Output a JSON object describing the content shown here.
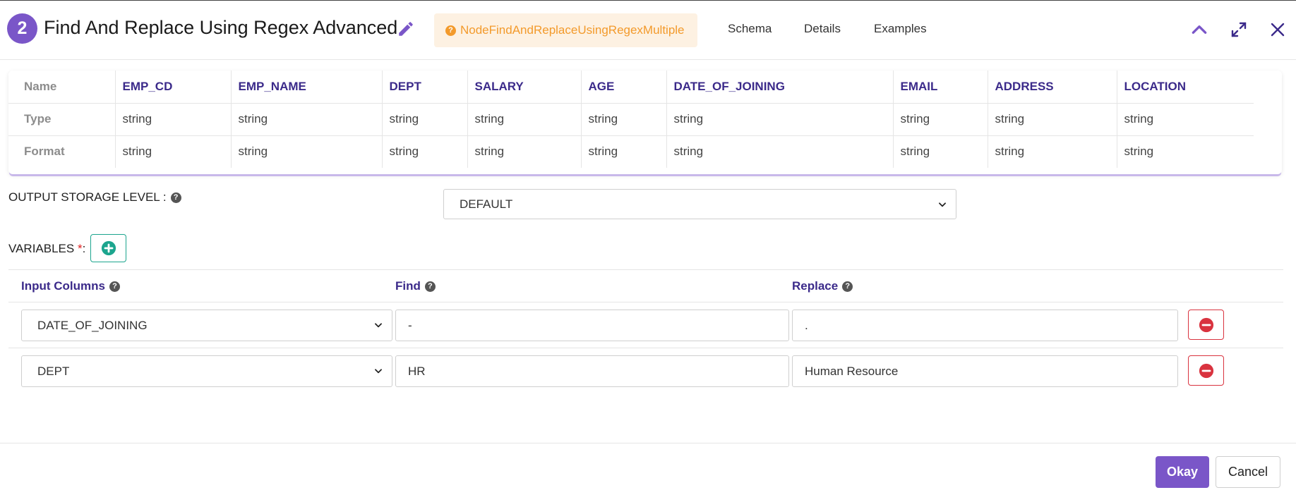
{
  "header": {
    "step_number": "2",
    "title": "Find And Replace Using Regex Advanced",
    "node_name": "NodeFindAndReplaceUsingRegexMultiple",
    "tabs": [
      "Schema",
      "Details",
      "Examples"
    ]
  },
  "schema": {
    "row_labels": [
      "Name",
      "Type",
      "Format"
    ],
    "columns": [
      "EMP_CD",
      "EMP_NAME",
      "DEPT",
      "SALARY",
      "AGE",
      "DATE_OF_JOINING",
      "EMAIL",
      "ADDRESS",
      "LOCATION"
    ],
    "types": [
      "string",
      "string",
      "string",
      "string",
      "string",
      "string",
      "string",
      "string",
      "string"
    ],
    "formats": [
      "string",
      "string",
      "string",
      "string",
      "string",
      "string",
      "string",
      "string",
      "string"
    ]
  },
  "storage": {
    "label": "OUTPUT STORAGE LEVEL :",
    "value": "DEFAULT"
  },
  "variables": {
    "label": "VARIABLES",
    "required_mark": "*",
    "separator": ":",
    "headers": {
      "input_columns": "Input Columns",
      "find": "Find",
      "replace": "Replace"
    },
    "rows": [
      {
        "input_column": "DATE_OF_JOINING",
        "find": "-",
        "replace": "."
      },
      {
        "input_column": "DEPT",
        "find": "HR",
        "replace": "Human Resource"
      }
    ]
  },
  "footer": {
    "okay_label": "Okay",
    "cancel_label": "Cancel"
  },
  "colors": {
    "accent": "#7a56c8",
    "header_text": "#3b2a8a",
    "node_pill_text": "#f39a2b",
    "node_pill_bg": "#fdf1e2",
    "add_button": "#1ca58e",
    "remove_button": "#d9333f"
  },
  "icons": {
    "edit": "pencil-icon",
    "collapse": "chevron-up-icon",
    "expand": "expand-icon",
    "close": "close-icon",
    "help": "question-circle-icon",
    "add": "plus-circle-icon",
    "remove": "minus-circle-icon"
  }
}
